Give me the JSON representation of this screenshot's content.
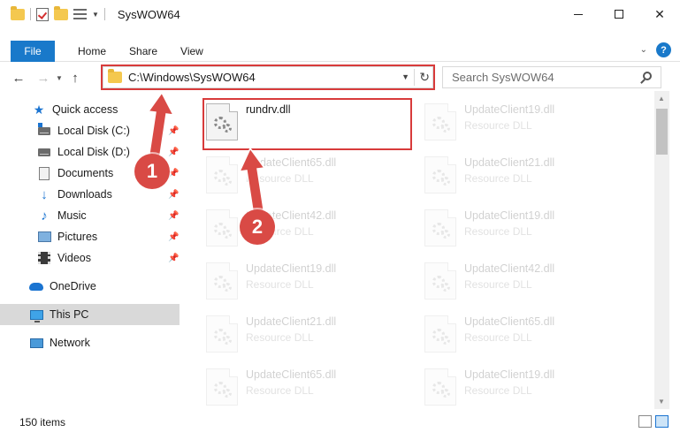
{
  "window": {
    "title": "SysWOW64"
  },
  "ribbon": {
    "tabs": [
      "File",
      "Home",
      "Share",
      "View"
    ],
    "help_label": "?"
  },
  "address_bar": {
    "path": "C:\\Windows\\SysWOW64",
    "search_placeholder": "Search SysWOW64"
  },
  "sidebar": {
    "items": [
      {
        "label": "Quick access",
        "icon": "star-icon",
        "pinned": false
      },
      {
        "label": "Local Disk (C:)",
        "icon": "drive-icon",
        "pinned": true
      },
      {
        "label": "Local Disk (D:)",
        "icon": "drive-icon",
        "pinned": true
      },
      {
        "label": "Documents",
        "icon": "documents-icon",
        "pinned": true
      },
      {
        "label": "Downloads",
        "icon": "downloads-icon",
        "pinned": true
      },
      {
        "label": "Music",
        "icon": "music-icon",
        "pinned": true
      },
      {
        "label": "Pictures",
        "icon": "pictures-icon",
        "pinned": true
      },
      {
        "label": "Videos",
        "icon": "videos-icon",
        "pinned": true
      },
      {
        "label": "OneDrive",
        "icon": "onedrive-icon",
        "pinned": false
      },
      {
        "label": "This PC",
        "icon": "this-pc-icon",
        "pinned": false,
        "selected": true
      },
      {
        "label": "Network",
        "icon": "network-icon",
        "pinned": false
      }
    ]
  },
  "files": [
    {
      "name": "rundrv.dll",
      "type": "",
      "highlighted": true
    },
    {
      "name": "UpdateClient19.dll",
      "type": "Resource DLL"
    },
    {
      "name": "UpdateClient65.dll",
      "type": "Resource DLL"
    },
    {
      "name": "UpdateClient21.dll",
      "type": "Resource DLL"
    },
    {
      "name": "UpdateClient42.dll",
      "type": "Resource DLL"
    },
    {
      "name": "UpdateClient19.dll",
      "type": "Resource DLL"
    },
    {
      "name": "UpdateClient19.dll",
      "type": "Resource DLL"
    },
    {
      "name": "UpdateClient42.dll",
      "type": "Resource DLL"
    },
    {
      "name": "UpdateClient21.dll",
      "type": "Resource DLL"
    },
    {
      "name": "UpdateClient65.dll",
      "type": "Resource DLL"
    },
    {
      "name": "UpdateClient65.dll",
      "type": "Resource DLL"
    },
    {
      "name": "UpdateClient19.dll",
      "type": "Resource DLL"
    }
  ],
  "status": {
    "item_count": "150 items"
  },
  "callouts": {
    "step1": "1",
    "step2": "2"
  },
  "colors": {
    "accent": "#1979ca",
    "highlight": "#d83b3b",
    "callout": "#d94a45"
  }
}
